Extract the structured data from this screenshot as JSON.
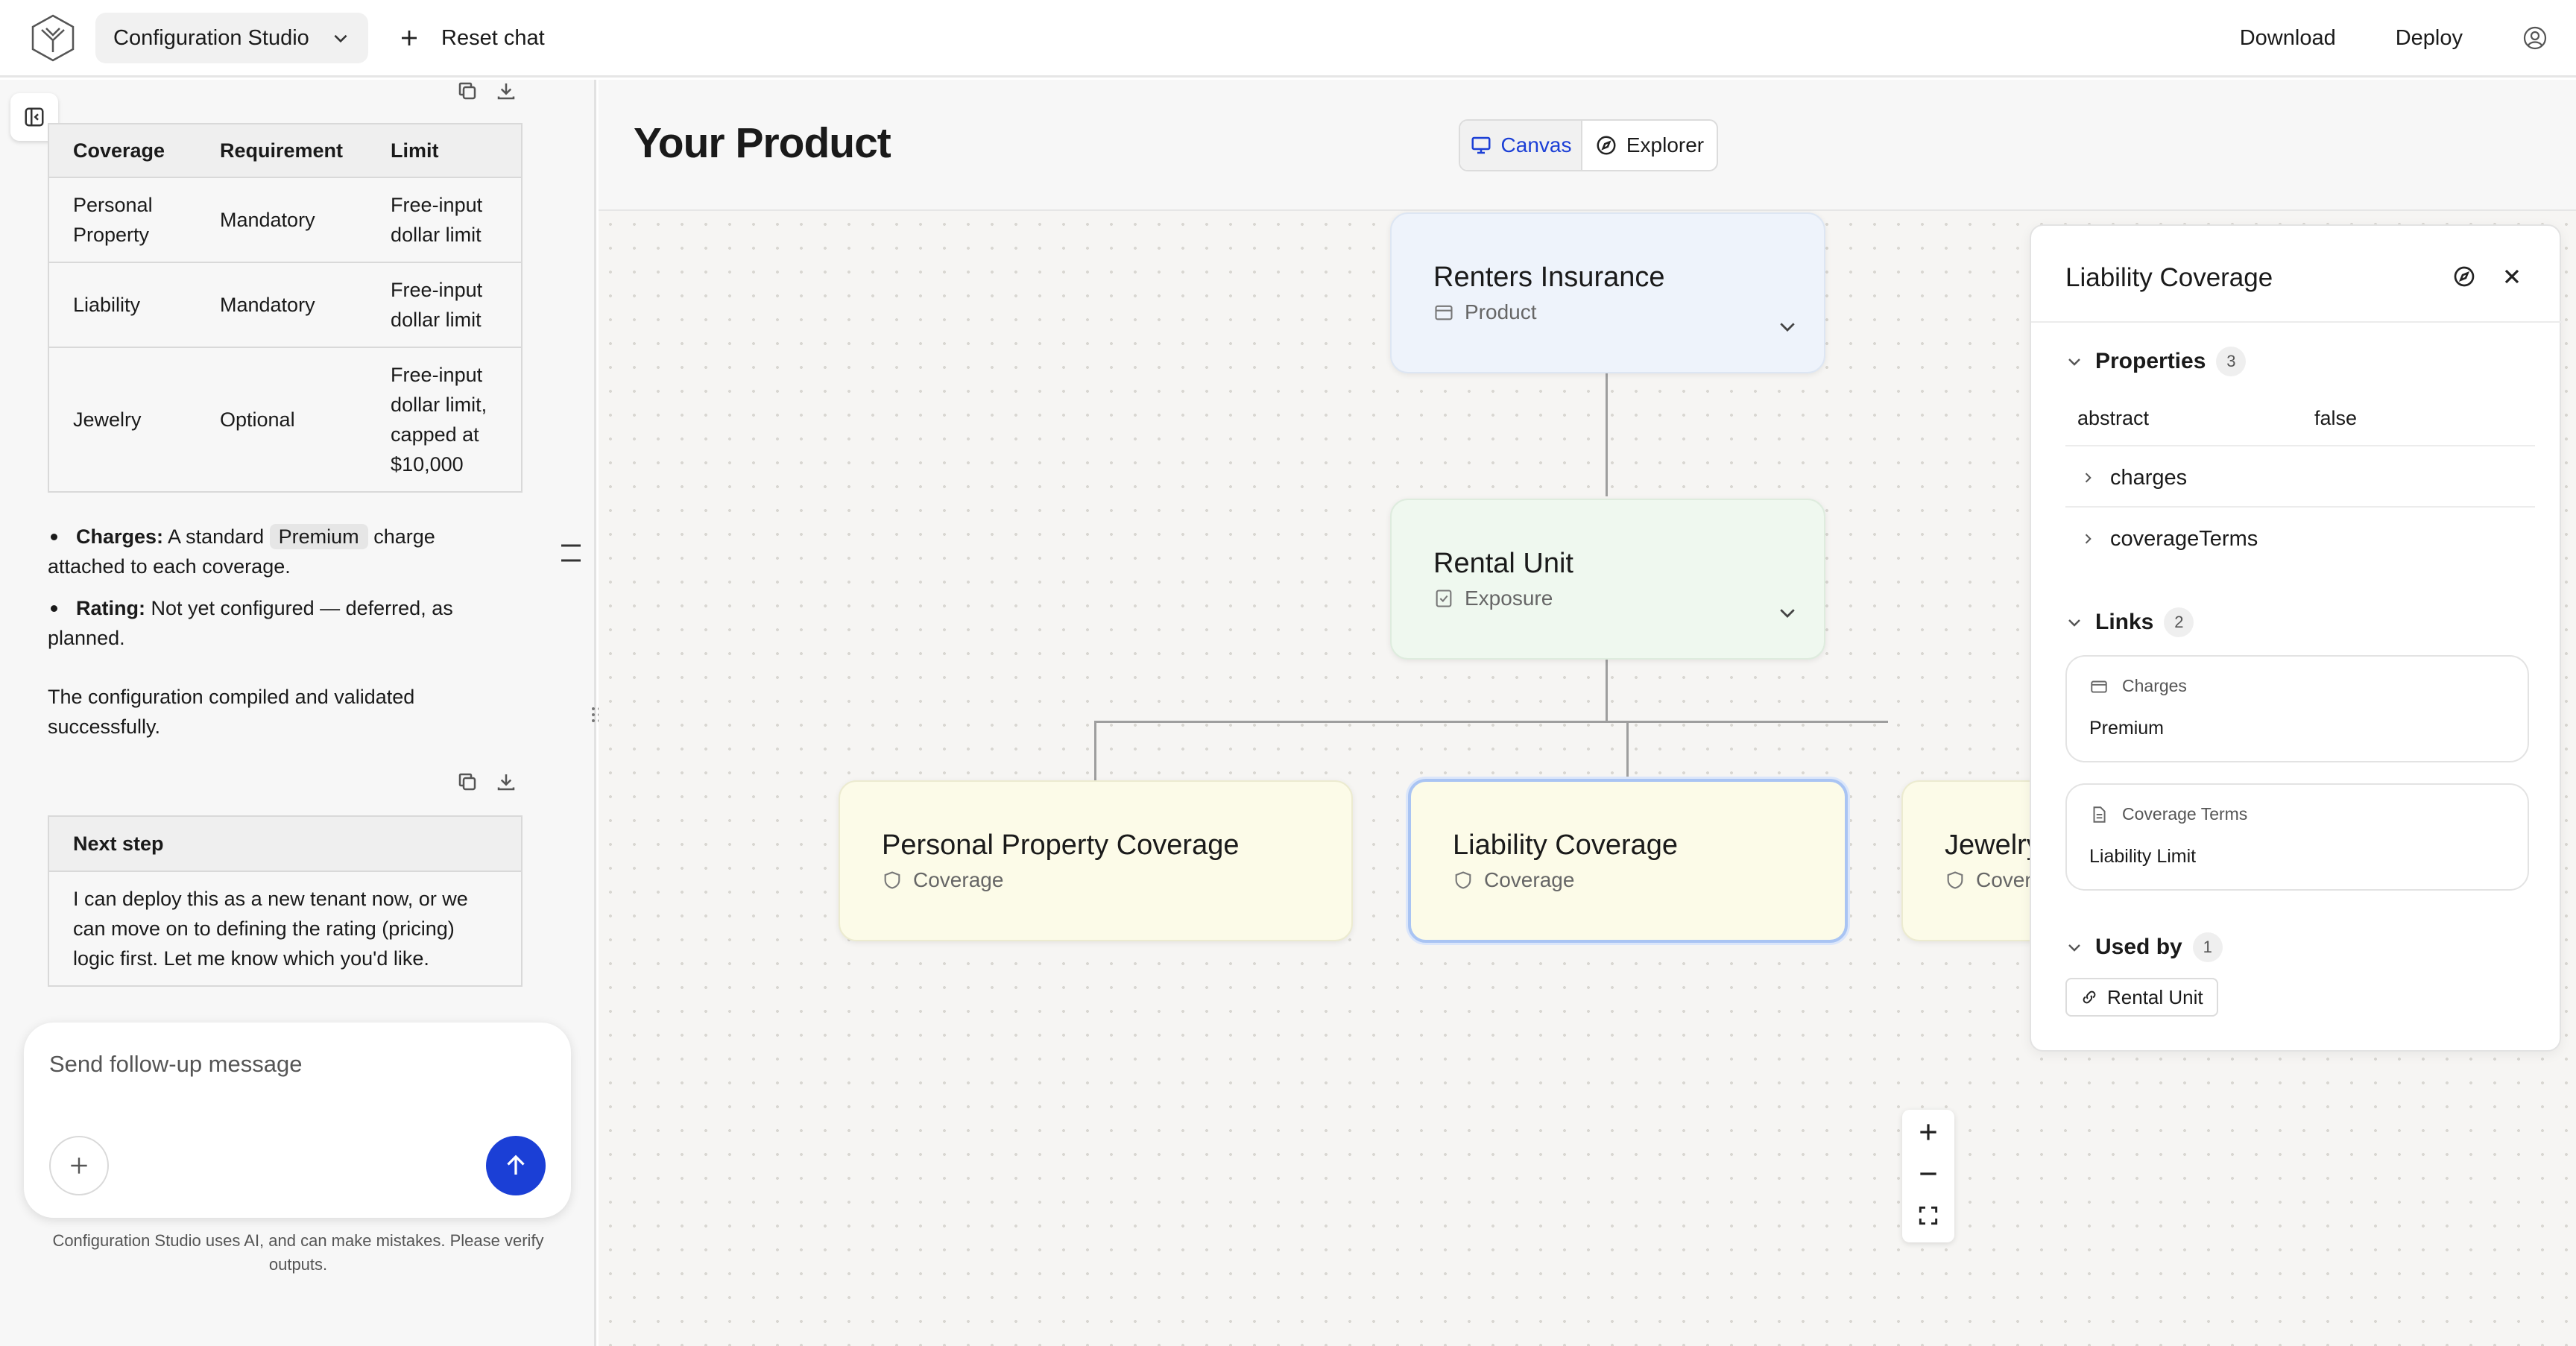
{
  "header": {
    "app_name": "Configuration Studio",
    "reset_label": "Reset chat",
    "download_label": "Download",
    "deploy_label": "Deploy"
  },
  "chat": {
    "table": {
      "headers": [
        "Coverage",
        "Requirement",
        "Limit"
      ],
      "rows": [
        [
          "Personal Property",
          "Mandatory",
          "Free-input dollar limit"
        ],
        [
          "Liability",
          "Mandatory",
          "Free-input dollar limit"
        ],
        [
          "Jewelry",
          "Optional",
          "Free-input dollar limit, capped at $10,000"
        ]
      ]
    },
    "bullets": {
      "charges_label": "Charges:",
      "charges_pre": "A standard",
      "charges_chip": "Premium",
      "charges_post": "charge",
      "charges_cont": "attached to each coverage.",
      "rating_label": "Rating:",
      "rating_text": "Not yet configured — deferred, as",
      "rating_cont": "planned."
    },
    "summary_line1": "The configuration compiled and validated",
    "summary_line2": "successfully.",
    "next_step": {
      "title": "Next step",
      "line1": "I can deploy this as a new tenant now, or we",
      "line2": "can move on to defining the rating (pricing)",
      "line3": "logic first. Let me know which you'd like."
    },
    "composer_placeholder": "Send follow-up message",
    "disclaimer_line1": "Configuration Studio uses AI, and can make mistakes. Please verify",
    "disclaimer_line2": "outputs."
  },
  "main": {
    "title": "Your Product",
    "view_canvas": "Canvas",
    "view_explorer": "Explorer"
  },
  "graph": {
    "product": {
      "name": "Renters Insurance",
      "type": "Product"
    },
    "exposure": {
      "name": "Rental Unit",
      "type": "Exposure"
    },
    "coverages": [
      {
        "name": "Personal Property Coverage",
        "type": "Coverage"
      },
      {
        "name": "Liability Coverage",
        "type": "Coverage"
      },
      {
        "name": "Jewelry Coverage",
        "type": "Coverage"
      }
    ]
  },
  "inspector": {
    "title": "Liability Coverage",
    "properties_label": "Properties",
    "properties_count": "3",
    "prop_abstract_key": "abstract",
    "prop_abstract_value": "false",
    "prop_charges": "charges",
    "prop_coverage_terms": "coverageTerms",
    "links_label": "Links",
    "links_count": "2",
    "link_charges_type": "Charges",
    "link_charges_value": "Premium",
    "link_terms_type": "Coverage Terms",
    "link_terms_value": "Liability Limit",
    "used_by_label": "Used by",
    "used_by_count": "1",
    "used_by_item": "Rental Unit"
  },
  "colors": {
    "accent": "#1b3fd6",
    "product_node": "#eef3fb",
    "exposure_node": "#eff8ef",
    "coverage_node": "#fcfbe8",
    "selected_border": "#a9c4f3"
  }
}
